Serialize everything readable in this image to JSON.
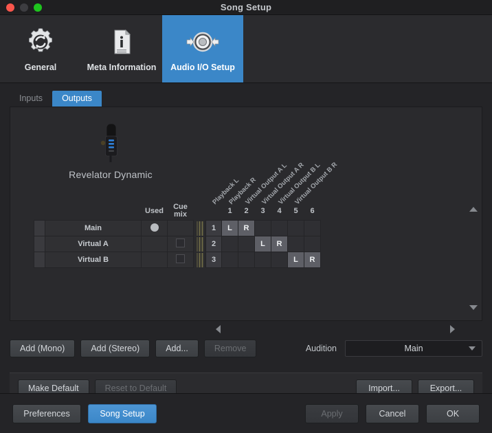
{
  "window": {
    "title": "Song Setup",
    "controls": [
      {
        "name": "close",
        "color": "#f9564c"
      },
      {
        "name": "minimize",
        "color": "#3d3d41"
      },
      {
        "name": "zoom",
        "color": "#1ec41e"
      }
    ]
  },
  "toolbar": {
    "items": [
      {
        "label": "General",
        "icon": "gear-refresh-icon",
        "selected": false
      },
      {
        "label": "Meta Information",
        "icon": "document-info-icon",
        "selected": false
      },
      {
        "label": "Audio I/O Setup",
        "icon": "audio-io-speaker-icon",
        "selected": true
      }
    ],
    "accent": "#3b87c8"
  },
  "tabs": [
    {
      "label": "Inputs",
      "active": false
    },
    {
      "label": "Outputs",
      "active": true
    }
  ],
  "device": {
    "name": "Revelator Dynamic",
    "icon": "microphone-icon"
  },
  "matrix": {
    "diagonal_headers": [
      "Playback L",
      "Playback R",
      "Virtual Output A L",
      "Virtual Output A R",
      "Virtual Output B L",
      "Virtual Output B R"
    ],
    "column_headers": {
      "used": "Used",
      "cue_mix_line1": "Cue",
      "cue_mix_line2": "mix"
    },
    "channel_numbers": [
      "1",
      "2",
      "3",
      "4",
      "5",
      "6"
    ],
    "rows": [
      {
        "name": "Main",
        "bus_number": "1",
        "used": true,
        "cue_mix": null,
        "cells": [
          "L",
          "R",
          "",
          "",
          "",
          ""
        ]
      },
      {
        "name": "Virtual A",
        "bus_number": "2",
        "used": false,
        "cue_mix": false,
        "cells": [
          "",
          "",
          "L",
          "R",
          "",
          ""
        ]
      },
      {
        "name": "Virtual B",
        "bus_number": "3",
        "used": false,
        "cue_mix": false,
        "cells": [
          "",
          "",
          "",
          "",
          "L",
          "R"
        ]
      }
    ]
  },
  "actions": {
    "add_mono": "Add (Mono)",
    "add_stereo": "Add (Stereo)",
    "add_more": "Add...",
    "remove": "Remove",
    "audition_label": "Audition",
    "audition_value": "Main"
  },
  "defaults": {
    "make_default": "Make Default",
    "reset_to_default": "Reset to Default",
    "import": "Import...",
    "export": "Export..."
  },
  "footer": {
    "preferences": "Preferences",
    "song_setup": "Song Setup",
    "apply": "Apply",
    "cancel": "Cancel",
    "ok": "OK"
  }
}
